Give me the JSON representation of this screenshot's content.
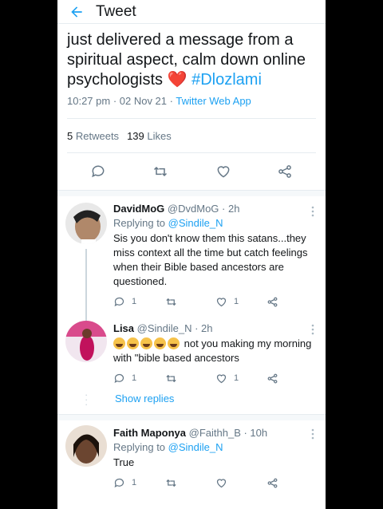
{
  "header": {
    "title": "Tweet"
  },
  "tweet": {
    "text": "just delivered a message from a spiritual aspect, calm down online psychologists",
    "emoji": "❤️",
    "hashtag": "#Dlozlami",
    "time": "10:27 pm · 02 Nov 21 ·",
    "app": "Twitter Web App",
    "retweets_count": "5",
    "retweets_label": "Retweets",
    "likes_count": "139",
    "likes_label": "Likes"
  },
  "replies": [
    {
      "name": "DavidMoG",
      "handle": "@DvdMoG · 2h",
      "replying_label": "Replying to",
      "mention": "@Sindile_N",
      "text": "Sis you don't know them this satans...they miss context all the time but catch feelings when their Bible based ancestors are questioned.",
      "reply_count": "1",
      "like_count": "1"
    },
    {
      "name": "Lisa",
      "handle": "@Sindile_N · 2h",
      "emoji": "😂😂😂😂😂",
      "text": " not you making my morning with \"bible based ancestors",
      "reply_count": "1",
      "like_count": "1",
      "show_replies": "Show replies"
    },
    {
      "name": "Faith Maponya",
      "handle": "@Faithh_B · 10h",
      "replying_label": "Replying to",
      "mention": "@Sindile_N",
      "text": "True",
      "reply_count": "1"
    }
  ]
}
